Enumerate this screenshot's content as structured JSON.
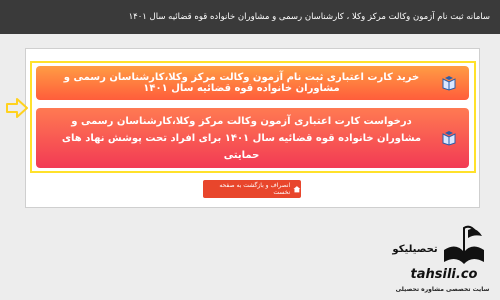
{
  "header": {
    "title": "سامانه ثبت نام آزمون وکالت مرکز وکلا ، کارشناسان رسمی و مشاوران خانواده قوه قضائیه سال ۱۴۰۱"
  },
  "main": {
    "button_buy_card": "خرید کارت اعتباری ثبت نام آزمون وکالت مرکز وکلا،کارشناسان رسمی و مشاوران خانواده قوه قضائیه سال ۱۴۰۱",
    "button_request_card": "درخواست کارت اعتباری آزمون وکالت مرکز وکلا،کارشناسان رسمی و مشاوران خانواده قوه قضائیه سال ۱۴۰۱ برای افراد تحت پوشش نهاد های حمایتی",
    "back_button": "انصراف و بازگشت به صفحه نخست"
  },
  "watermark": {
    "brand_fa": "تحصیلیکو",
    "domain": "tahsili.co",
    "tagline": "سایت تخصصی مشاوره تحصیلی"
  },
  "colors": {
    "header_bg": "#3a3a3a",
    "highlight_border": "#ffe12b",
    "button_orange": "#ff7a3f",
    "button_red": "#f23a54",
    "back_button": "#e8462c"
  },
  "icons": [
    "graduation-book-icon",
    "graduation-book-icon",
    "arrow-right-icon",
    "home-icon"
  ]
}
